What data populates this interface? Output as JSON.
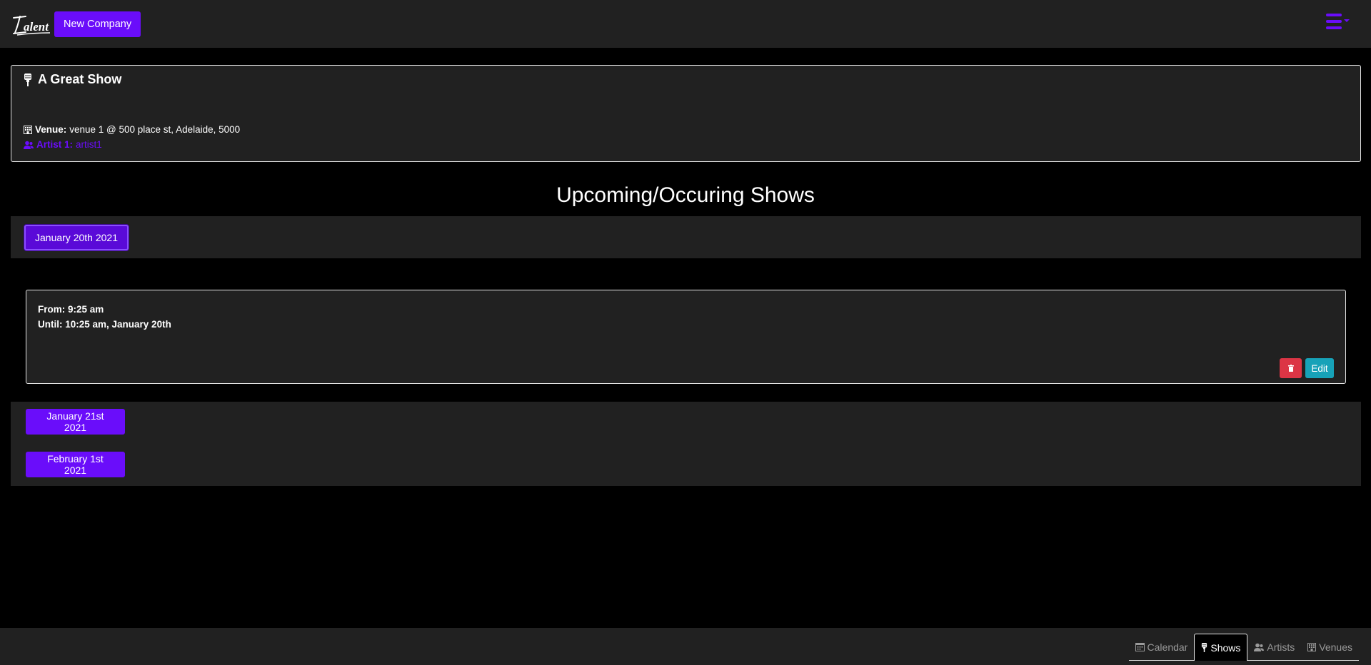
{
  "header": {
    "logo_text": "Talent",
    "new_company_label": "New Company",
    "menu_icon": "hamburger-icon"
  },
  "show": {
    "title": "A Great Show",
    "title_icon": "microphone-icon",
    "venue_label": "Venue:",
    "venue_value": "venue 1 @ 500 place st, Adelaide, 5000",
    "artist_label": "Artist 1:",
    "artist_value": "artist1"
  },
  "section": {
    "heading": "Upcoming/Occuring Shows"
  },
  "dates": [
    {
      "label": "January 20th 2021",
      "expanded": true,
      "slot": {
        "from": "From: 9:25 am",
        "until": "Until: 10:25 am, January 20th",
        "edit_label": "Edit"
      }
    },
    {
      "label": "January 21st 2021",
      "expanded": false
    },
    {
      "label": "February 1st 2021",
      "expanded": false
    }
  ],
  "bottom_nav": {
    "tabs": [
      {
        "label": "Calendar",
        "icon": "calendar-icon",
        "active": false
      },
      {
        "label": "Shows",
        "icon": "microphone-icon",
        "active": true
      },
      {
        "label": "Artists",
        "icon": "users-icon",
        "active": false
      },
      {
        "label": "Venues",
        "icon": "building-icon",
        "active": false
      }
    ]
  },
  "colors": {
    "primary": "#6a0dfa",
    "danger": "#dc3545",
    "info": "#17a2b8",
    "surface": "#212121",
    "background": "#000000"
  }
}
